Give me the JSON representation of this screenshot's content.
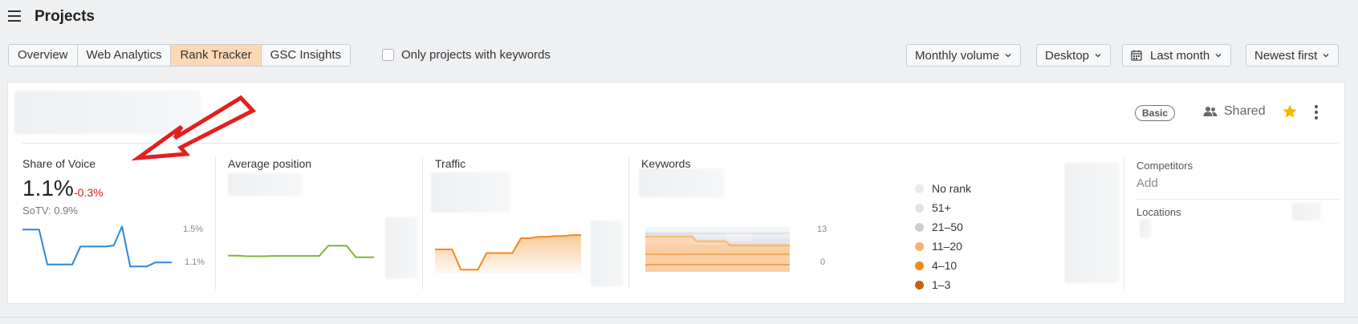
{
  "page": {
    "title": "Projects"
  },
  "tabs": [
    {
      "label": "Overview",
      "active": false
    },
    {
      "label": "Web Analytics",
      "active": false
    },
    {
      "label": "Rank Tracker",
      "active": true
    },
    {
      "label": "GSC Insights",
      "active": false
    }
  ],
  "filters": {
    "only_keywords_label": "Only projects with keywords",
    "only_keywords_checked": false,
    "volume": "Monthly volume",
    "device": "Desktop",
    "period": "Last month",
    "sort": "Newest first"
  },
  "project": {
    "plan_badge": "Basic",
    "shared_label": "Shared",
    "starred": true
  },
  "metrics": {
    "sov": {
      "title": "Share of Voice",
      "value": "1.1%",
      "delta": "-0.3%",
      "sotv": "SoTV: 0.9%",
      "y_max_label": "1.5%",
      "y_min_label": "1.1%",
      "series": [
        1.45,
        1.45,
        1.45,
        1.1,
        1.1,
        1.1,
        1.1,
        1.28,
        1.28,
        1.28,
        1.28,
        1.29,
        1.48,
        1.08,
        1.08,
        1.08,
        1.12,
        1.12,
        1.12
      ]
    },
    "avg_position": {
      "title": "Average position",
      "series": [
        0.3,
        0.3,
        0.28,
        0.28,
        0.28,
        0.29,
        0.29,
        0.29,
        0.29,
        0.29,
        0.29,
        0.6,
        0.6,
        0.6,
        0.25,
        0.25,
        0.25
      ]
    },
    "traffic": {
      "title": "Traffic",
      "series": [
        0.5,
        0.5,
        0.5,
        0.05,
        0.05,
        0.05,
        0.42,
        0.42,
        0.42,
        0.42,
        0.75,
        0.75,
        0.78,
        0.78,
        0.8,
        0.8,
        0.82,
        0.82
      ]
    },
    "keywords": {
      "title": "Keywords",
      "y_max_label": "13",
      "y_min_label": "0",
      "legend": [
        {
          "label": "No rank",
          "color": "#e7eaee"
        },
        {
          "label": "51+",
          "color": "#dfe3e8"
        },
        {
          "label": "21–50",
          "color": "#c9ced5"
        },
        {
          "label": "11–20",
          "color": "#f6b26b"
        },
        {
          "label": "4–10",
          "color": "#f08a1c"
        },
        {
          "label": "1–3",
          "color": "#c8650a"
        }
      ]
    }
  },
  "sidebar": {
    "competitors_label": "Competitors",
    "competitors_action": "Add",
    "locations_label": "Locations"
  },
  "colors": {
    "accent_tab": "#fdd8b5",
    "sov_line": "#2e86d6",
    "avgpos_line": "#7fb53a",
    "traffic_line": "#f08a1c",
    "annotation_arrow": "#e41f1f"
  }
}
